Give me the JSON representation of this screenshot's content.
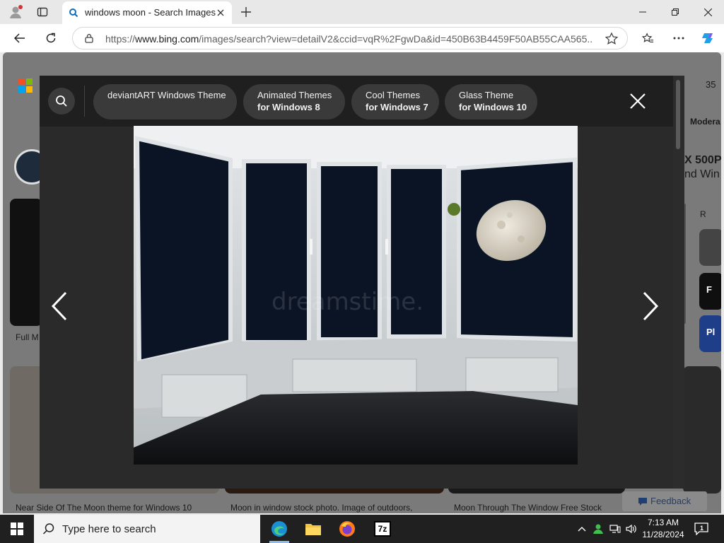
{
  "browser": {
    "tab_title": "windows moon - Search Images",
    "url_prefix": "https://",
    "url_host": "www.bing.com",
    "url_path": "/images/search?view=detailV2&ccid=vqR%2FgwDa&id=450B63B4459F50AB55CAA565..."
  },
  "page_behind": {
    "count_fragment": "35",
    "filter_fragment": "Modera",
    "product_fragment_1": "X 500P",
    "product_fragment_2": "nd Win",
    "side_label_1": "Full M",
    "side_button_1": "F",
    "side_button_2": "Pl",
    "caption_1": "Near Side Of The Moon theme for Windows 10",
    "caption_2": "Moon in window stock photo. Image of outdoors,",
    "caption_3": "Moon Through The Window Free Stock",
    "feedback_label": "Feedback",
    "cart_fragment": "R"
  },
  "viewer": {
    "chips": [
      {
        "line1": "deviantART Windows Theme",
        "line2": ""
      },
      {
        "line1": "Animated Themes",
        "line2": "for Windows 8"
      },
      {
        "line1": "Cool Themes",
        "line2": "for Windows 7"
      },
      {
        "line1": "Glass Theme",
        "line2": "for Windows 10"
      }
    ],
    "watermark": "dreamstime."
  },
  "taskbar": {
    "search_placeholder": "Type here to search",
    "time": "7:13 AM",
    "date": "11/28/2024",
    "notification_count": "1",
    "sevenzip_label": "7z"
  },
  "colors": {
    "accent_blue": "#0078d4",
    "overlay_bg": "#2a2a2a",
    "chip_bg": "#3a3a3a",
    "night_sky": "#0b1424"
  }
}
